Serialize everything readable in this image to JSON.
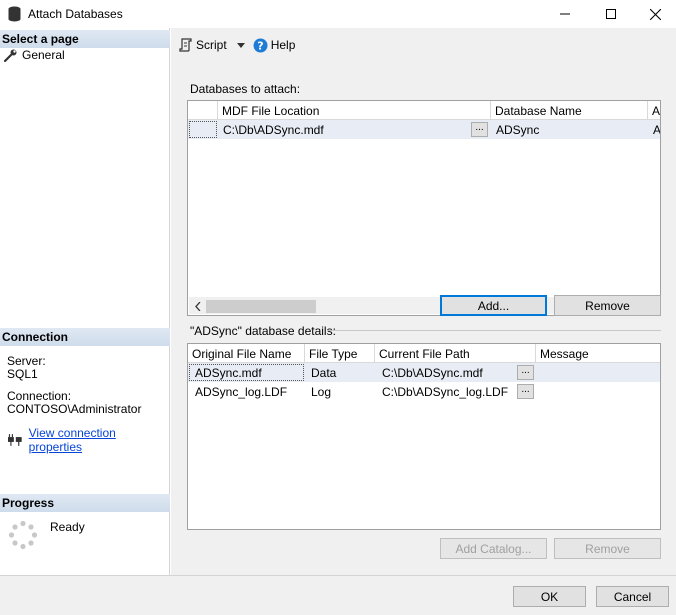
{
  "window": {
    "title": "Attach Databases"
  },
  "left": {
    "select_page": "Select a page",
    "general": "General",
    "connection_header": "Connection",
    "server_label": "Server:",
    "server_value": "SQL1",
    "connection_label": "Connection:",
    "connection_value": "CONTOSO\\Administrator",
    "view_connection": "View connection properties",
    "progress_header": "Progress",
    "progress_status": "Ready"
  },
  "toolbar": {
    "script_label": "Script",
    "help_label": "Help"
  },
  "attach": {
    "label": "Databases to attach:",
    "columns": [
      "MDF File Location",
      "Database Name",
      "At"
    ],
    "rows": [
      {
        "mdf": "C:\\Db\\ADSync.mdf",
        "ellipsis": "...",
        "name": "ADSync",
        "attach_as": "A"
      }
    ],
    "add_button": "Add...",
    "remove_button": "Remove"
  },
  "details": {
    "label": "\"ADSync\" database details:",
    "columns": [
      "Original File Name",
      "File Type",
      "Current File Path",
      "Message"
    ],
    "rows": [
      {
        "original": "ADSync.mdf",
        "type": "Data",
        "path": "C:\\Db\\ADSync.mdf",
        "ellipsis": "..."
      },
      {
        "original": "ADSync_log.LDF",
        "type": "Log",
        "path": "C:\\Db\\ADSync_log.LDF",
        "ellipsis": "..."
      }
    ],
    "add_catalog_button": "Add Catalog...",
    "remove_button": "Remove"
  },
  "footer": {
    "ok_button": "OK",
    "cancel_button": "Cancel"
  }
}
